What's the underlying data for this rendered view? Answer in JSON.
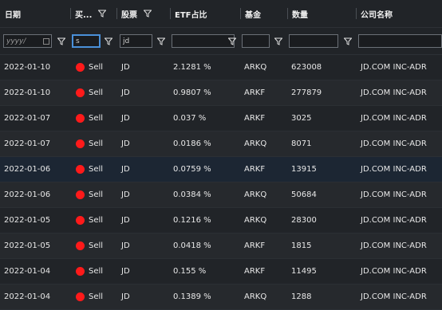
{
  "columns": {
    "date": "日期",
    "action": "买...",
    "ticker": "股票",
    "etf_pct": "ETF占比",
    "fund": "基金",
    "qty": "数量",
    "company": "公司名称"
  },
  "filters": {
    "date_placeholder": "yyyy/",
    "action_value": "s",
    "ticker_value": "jd",
    "etf_pct_value": "",
    "fund_value": "",
    "qty_value": "",
    "company_value": ""
  },
  "colors": {
    "sell_dot": "#ff1a1a",
    "active_border": "#4a90d9"
  },
  "rows": [
    {
      "date": "2022-01-10",
      "action": "Sell",
      "ticker": "JD",
      "etf_pct": "2.1281 %",
      "fund": "ARKQ",
      "qty": "623008",
      "company": "JD.COM INC-ADR"
    },
    {
      "date": "2022-01-10",
      "action": "Sell",
      "ticker": "JD",
      "etf_pct": "0.9807 %",
      "fund": "ARKF",
      "qty": "277879",
      "company": "JD.COM INC-ADR"
    },
    {
      "date": "2022-01-07",
      "action": "Sell",
      "ticker": "JD",
      "etf_pct": "0.037 %",
      "fund": "ARKF",
      "qty": "3025",
      "company": "JD.COM INC-ADR"
    },
    {
      "date": "2022-01-07",
      "action": "Sell",
      "ticker": "JD",
      "etf_pct": "0.0186 %",
      "fund": "ARKQ",
      "qty": "8071",
      "company": "JD.COM INC-ADR"
    },
    {
      "date": "2022-01-06",
      "action": "Sell",
      "ticker": "JD",
      "etf_pct": "0.0759 %",
      "fund": "ARKF",
      "qty": "13915",
      "company": "JD.COM INC-ADR"
    },
    {
      "date": "2022-01-06",
      "action": "Sell",
      "ticker": "JD",
      "etf_pct": "0.0384 %",
      "fund": "ARKQ",
      "qty": "50684",
      "company": "JD.COM INC-ADR"
    },
    {
      "date": "2022-01-05",
      "action": "Sell",
      "ticker": "JD",
      "etf_pct": "0.1216 %",
      "fund": "ARKQ",
      "qty": "28300",
      "company": "JD.COM INC-ADR"
    },
    {
      "date": "2022-01-05",
      "action": "Sell",
      "ticker": "JD",
      "etf_pct": "0.0418 %",
      "fund": "ARKF",
      "qty": "1815",
      "company": "JD.COM INC-ADR"
    },
    {
      "date": "2022-01-04",
      "action": "Sell",
      "ticker": "JD",
      "etf_pct": "0.155 %",
      "fund": "ARKF",
      "qty": "11495",
      "company": "JD.COM INC-ADR"
    },
    {
      "date": "2022-01-04",
      "action": "Sell",
      "ticker": "JD",
      "etf_pct": "0.1389 %",
      "fund": "ARKQ",
      "qty": "1288",
      "company": "JD.COM INC-ADR"
    }
  ]
}
